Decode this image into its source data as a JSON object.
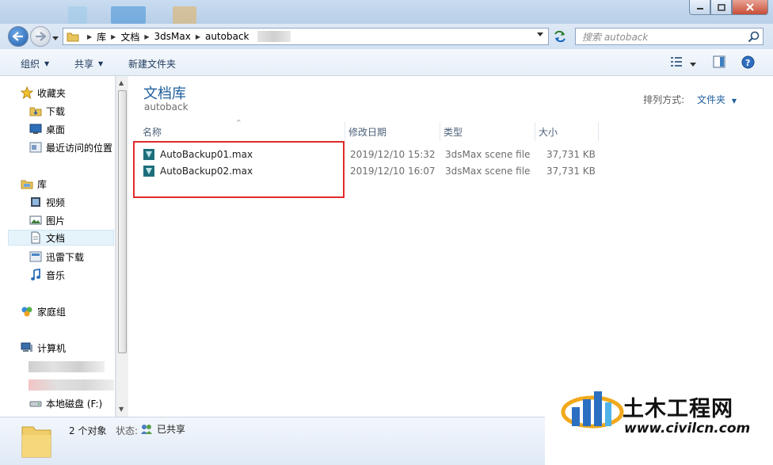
{
  "address_bar": {
    "breadcrumbs": [
      "库",
      "文档",
      "3dsMax",
      "autoback"
    ],
    "search_placeholder": "搜索 autoback"
  },
  "toolbar": {
    "organize_label": "组织",
    "share_label": "共享",
    "new_folder_label": "新建文件夹"
  },
  "sidebar": {
    "favorites": {
      "label": "收藏夹",
      "items": [
        {
          "label": "下载",
          "icon": "download-folder-icon"
        },
        {
          "label": "桌面",
          "icon": "desktop-icon"
        },
        {
          "label": "最近访问的位置",
          "icon": "recent-places-icon"
        }
      ]
    },
    "libraries": {
      "label": "库",
      "items": [
        {
          "label": "视频",
          "icon": "video-library-icon"
        },
        {
          "label": "图片",
          "icon": "pictures-library-icon"
        },
        {
          "label": "文档",
          "icon": "documents-library-icon",
          "selected": true
        },
        {
          "label": "迅雷下载",
          "icon": "thunder-download-icon"
        },
        {
          "label": "音乐",
          "icon": "music-library-icon"
        }
      ]
    },
    "homegroup": {
      "label": "家庭组"
    },
    "computer": {
      "label": "计算机",
      "items": [
        {
          "label": "本地磁盘 (F:)",
          "icon": "local-disk-icon"
        }
      ]
    }
  },
  "main": {
    "library_title": "文档库",
    "library_subtitle": "autoback",
    "arrange_label": "排列方式:",
    "arrange_value": "文件夹",
    "columns": [
      "名称",
      "修改日期",
      "类型",
      "大小"
    ],
    "files": [
      {
        "name": "AutoBackup01.max",
        "modified": "2019/12/10 15:32",
        "type": "3dsMax scene file",
        "size": "37,731 KB"
      },
      {
        "name": "AutoBackup02.max",
        "modified": "2019/12/10 16:07",
        "type": "3dsMax scene file",
        "size": "37,731 KB"
      }
    ],
    "highlight_color": "#e02b2b"
  },
  "status_bar": {
    "count": "2 个对象",
    "state_label": "状态:",
    "state_value": "已共享"
  },
  "watermark": {
    "text": "土木工程网",
    "url": "www.civilcn.com"
  }
}
